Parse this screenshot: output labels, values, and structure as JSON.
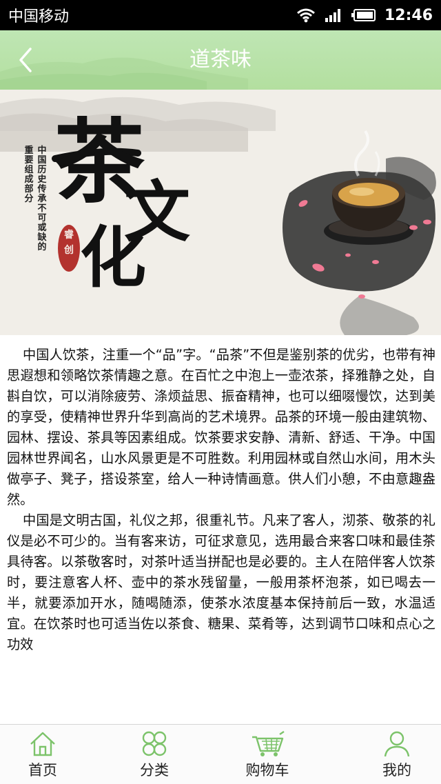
{
  "status_bar": {
    "carrier": "中国移动",
    "time": "12:46"
  },
  "nav": {
    "title": "道茶味"
  },
  "banner": {
    "vertical_text_1": "重要组成部分",
    "vertical_text_2": "中国历史传承不可或缺的",
    "char_1": "茶",
    "char_2": "文",
    "char_3": "化",
    "seal_text": "睿创"
  },
  "article": {
    "paragraphs": [
      "中国人饮茶，注重一个“品”字。“品茶”不但是鉴别茶的优劣，也带有神思遐想和领略饮茶情趣之意。在百忙之中泡上一壶浓茶，择雅静之处，自斟自饮，可以消除疲劳、涤烦益思、振奋精神，也可以细啜慢饮，达到美的享受，使精神世界升华到高尚的艺术境界。品茶的环境一般由建筑物、园林、摆设、茶具等因素组成。饮茶要求安静、清新、舒适、干净。中国园林世界闻名，山水风景更是不可胜数。利用园林或自然山水间，用木头做亭子、凳子，搭设茶室，给人一种诗情画意。供人们小憩，不由意趣盎然。",
      "中国是文明古国，礼仪之邦，很重礼节。凡来了客人，沏茶、敬茶的礼仪是必不可少的。当有客来访，可征求意见，选用最合来客口味和最佳茶具待客。以茶敬客时，对茶叶适当拼配也是必要的。主人在陪伴客人饮茶时，要注意客人杯、壶中的茶水残留量，一般用茶杯泡茶，如已喝去一半，就要添加开水，随喝随添，使茶水浓度基本保持前后一致，水温适宜。在饮茶时也可适当佐以茶食、糖果、菜肴等，达到调节口味和点心之功效"
    ]
  },
  "tabs": [
    {
      "label": "首页",
      "icon": "home-icon"
    },
    {
      "label": "分类",
      "icon": "category-icon"
    },
    {
      "label": "购物车",
      "icon": "cart-icon"
    },
    {
      "label": "我的",
      "icon": "user-icon"
    }
  ],
  "colors": {
    "accent": "#7cc36a",
    "nav_bg": "#b8e2a8"
  }
}
